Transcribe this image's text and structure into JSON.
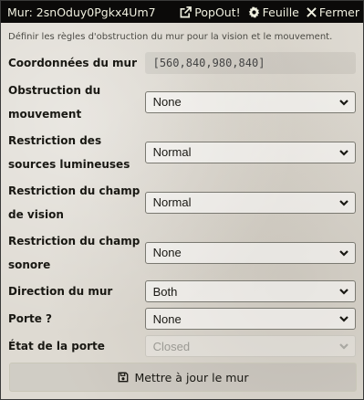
{
  "window": {
    "title": "Mur: 2snOduy0Pgkx4Um7",
    "buttons": [
      {
        "label": "PopOut!",
        "icon": "external-link-icon"
      },
      {
        "label": "Feuille",
        "icon": "gear-icon"
      },
      {
        "label": "Fermer",
        "icon": "close-icon"
      }
    ]
  },
  "form": {
    "notes": "Définir les règles d'obstruction du mur pour la vision et le mouvement.",
    "coords": {
      "label": "Coordonnées du mur",
      "value": "[560,840,980,840]"
    },
    "movement": {
      "label": "Obstruction du mouvement",
      "value": "None"
    },
    "light": {
      "label": "Restriction des sources lumineuses",
      "value": "Normal"
    },
    "sight": {
      "label": "Restriction du champ de vision",
      "value": "Normal"
    },
    "sound": {
      "label": "Restriction du champ sonore",
      "value": "None"
    },
    "direction": {
      "label": "Direction du mur",
      "value": "Both"
    },
    "door": {
      "label": "Porte ?",
      "value": "None"
    },
    "door_state": {
      "label": "État de la porte",
      "value": "Closed"
    },
    "submit_label": "Mettre à jour le mur"
  },
  "colors": {
    "header_bg": "#0b0a09",
    "header_text": "#f0f0e0",
    "background": "#dedad2"
  }
}
